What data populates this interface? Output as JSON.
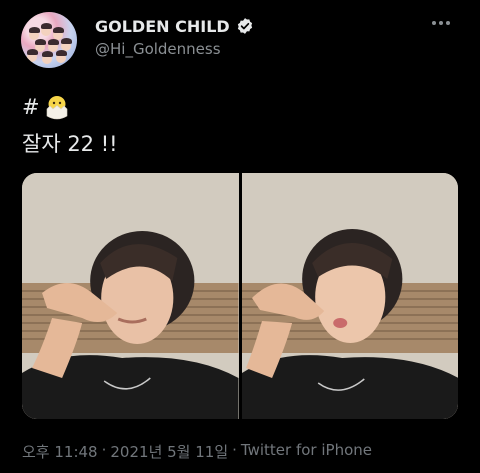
{
  "author": {
    "name": "GOLDEN CHILD",
    "handle": "@Hi_Goldenness",
    "verified": true
  },
  "tweet": {
    "hashtag_symbol": "#",
    "hashtag_emoji": "hatching-chick-emoji",
    "text": "잘자 22 !!"
  },
  "media": {
    "count": 2
  },
  "footer": {
    "time": "오후 11:48",
    "date": "2021년 5월 11일",
    "separator": "·",
    "source": "Twitter for iPhone"
  },
  "colors": {
    "background": "#000000",
    "text": "#e7e9ea",
    "secondary": "#71767b",
    "verified_badge": "#e7e9ea"
  }
}
